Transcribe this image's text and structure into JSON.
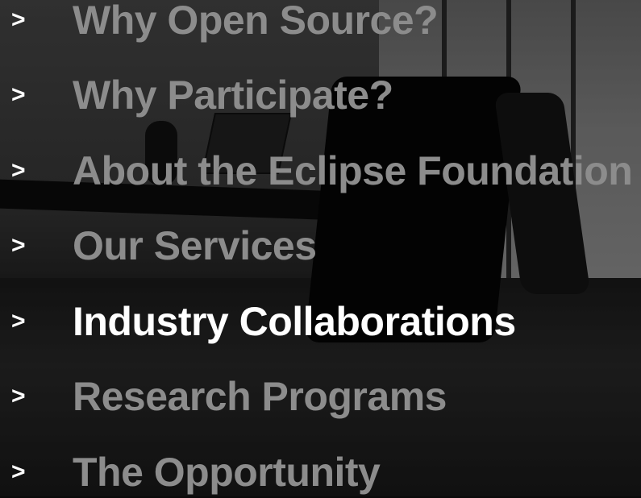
{
  "menu": {
    "bullet": ">",
    "items": [
      {
        "label": "Why Open Source?"
      },
      {
        "label": "Why Participate?"
      },
      {
        "label": "About the Eclipse Foundation"
      },
      {
        "label": "Our Services"
      },
      {
        "label": "Industry Collaborations",
        "active": true
      },
      {
        "label": "Research Programs"
      },
      {
        "label": "The Opportunity"
      }
    ]
  },
  "colors": {
    "inactive_text": "#8c8c8c",
    "active_text": "#ffffff",
    "bullet": "#ffffff"
  },
  "background": {
    "description_icon": "conference-room-photo"
  }
}
